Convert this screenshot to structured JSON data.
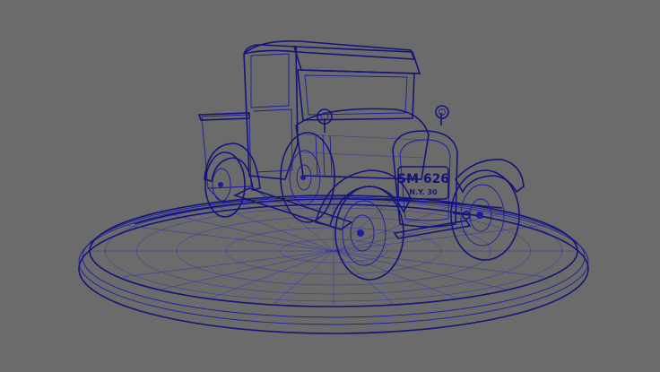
{
  "viewport": {
    "background_color": "#6b6b6b",
    "mesh_fill_color": "#a9a9a9",
    "wire_color": "#1c1ca0"
  },
  "model": {
    "plate_number": "SM 626",
    "plate_subtext": "N.Y. 30"
  }
}
